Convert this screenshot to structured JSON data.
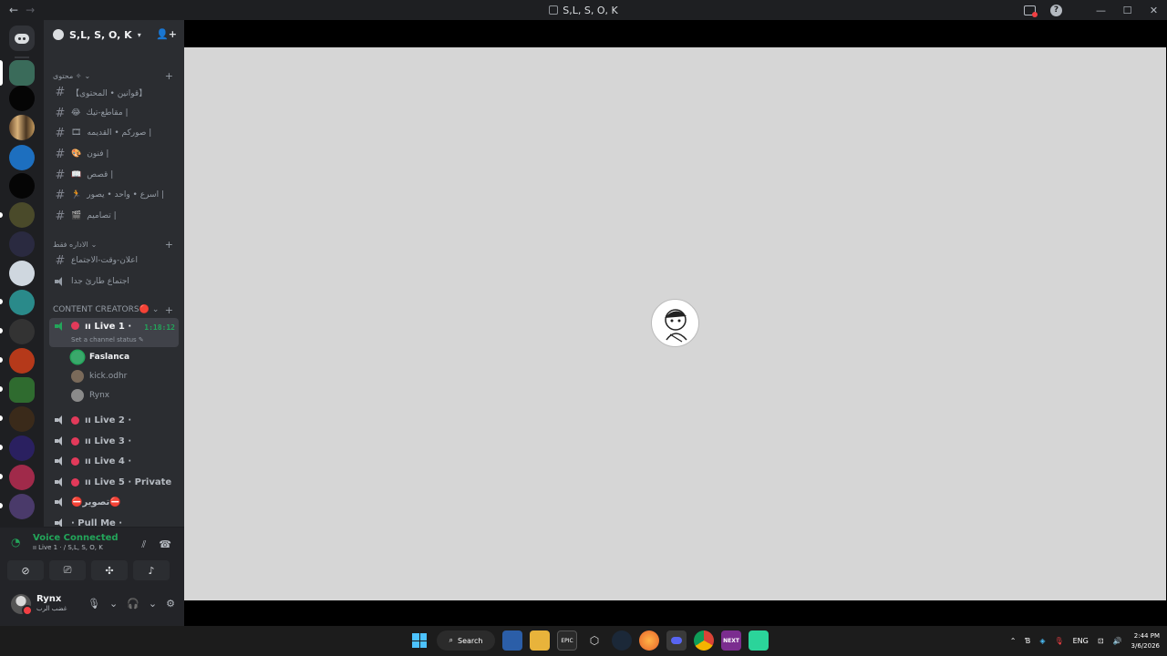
{
  "window": {
    "title": "S,L, S, O, K",
    "nav_back": "←",
    "nav_forward": "→",
    "help": "?",
    "minimize": "—",
    "maximize": "☐",
    "close": "✕"
  },
  "server": {
    "name": "S,L, S, O, K",
    "categories": [
      {
        "label": "محتوى ✧",
        "channels": [
          {
            "name": "【قوانين • المحتوى】",
            "emoji": ""
          },
          {
            "name": "مقاطع-تيك |",
            "emoji": "😂"
          },
          {
            "name": "صوركم • القديمه |",
            "emoji": "🎞"
          },
          {
            "name": "فنون |",
            "emoji": "🎨"
          },
          {
            "name": "قصص |",
            "emoji": "📖"
          },
          {
            "name": "اسرع • واحد • يصور |",
            "emoji": "🏃"
          },
          {
            "name": "تصاميم |",
            "emoji": "🎬"
          }
        ]
      },
      {
        "label": "الاداره فقط",
        "channels": [
          {
            "name": "اعلان-وقت-الاجتماع"
          },
          {
            "name": "اجتماع طارئ جدا"
          }
        ]
      },
      {
        "label": "CONTENT CREATORS🔴"
      }
    ],
    "voice_channels": [
      {
        "name": "ıı Live 1 ·",
        "timer": "1:18:12",
        "status": "Set a channel status"
      },
      {
        "name": "ıı Live 2 ·"
      },
      {
        "name": "ıı Live 3 ·"
      },
      {
        "name": "ıı Live 4 ·"
      },
      {
        "name": "ıı Live 5 · Private"
      },
      {
        "name": "⛔تصوير⛔"
      },
      {
        "name": "· Pull Me ·"
      }
    ],
    "members": [
      {
        "name": "Faslanca",
        "color": "#3aa86b"
      },
      {
        "name": "kick.odhr",
        "color": "#7a6a5a"
      },
      {
        "name": "Rynx",
        "color": "#8a8a8a"
      }
    ]
  },
  "voice": {
    "title": "Voice Connected",
    "sub": "ıı Live 1 · / S,L, S, O, K"
  },
  "user": {
    "name": "Rynx",
    "status": "غضب الرب"
  },
  "taskbar": {
    "search": "Search",
    "lang": "ENG",
    "time": "2:44 PM",
    "date": "3/6/2026",
    "next_label": "NEXT",
    "epic_label": "EPIC"
  },
  "colors": {
    "accent_green": "#23a55a",
    "live_red": "#e23a5a",
    "sidebar": "#2b2d31",
    "stage_bg": "#d6d6d6"
  }
}
